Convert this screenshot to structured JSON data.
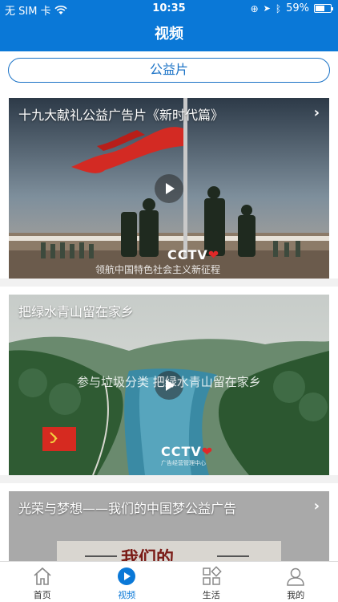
{
  "status_bar": {
    "carrier": "无 SIM 卡",
    "time": "10:35",
    "battery_pct": "59%",
    "battery_level": 0.59
  },
  "nav": {
    "title": "视频"
  },
  "category": {
    "label": "公益片"
  },
  "videos": [
    {
      "title": "十九大献礼公益广告片《新时代篇》",
      "caption": "领航中国特色社会主义新征程",
      "logo": "CCTV",
      "logo_heart": "❤"
    },
    {
      "title": "把绿水青山留在家乡",
      "caption": "参与垃圾分类  把绿水青山留在家乡",
      "logo": "CCTV",
      "logo_heart": "❤",
      "logo_sub": "广告经营管理中心"
    },
    {
      "title": "光荣与梦想——我们的中国梦公益广告",
      "caption": "我们的"
    }
  ],
  "tabs": [
    {
      "label": "首页",
      "icon": "home-icon",
      "active": false
    },
    {
      "label": "视频",
      "icon": "play-circle-icon",
      "active": true
    },
    {
      "label": "生活",
      "icon": "grid-icon",
      "active": false
    },
    {
      "label": "我的",
      "icon": "person-icon",
      "active": false
    }
  ],
  "colors": {
    "brand": "#0a78d7",
    "pill_border": "#1a72c6"
  }
}
